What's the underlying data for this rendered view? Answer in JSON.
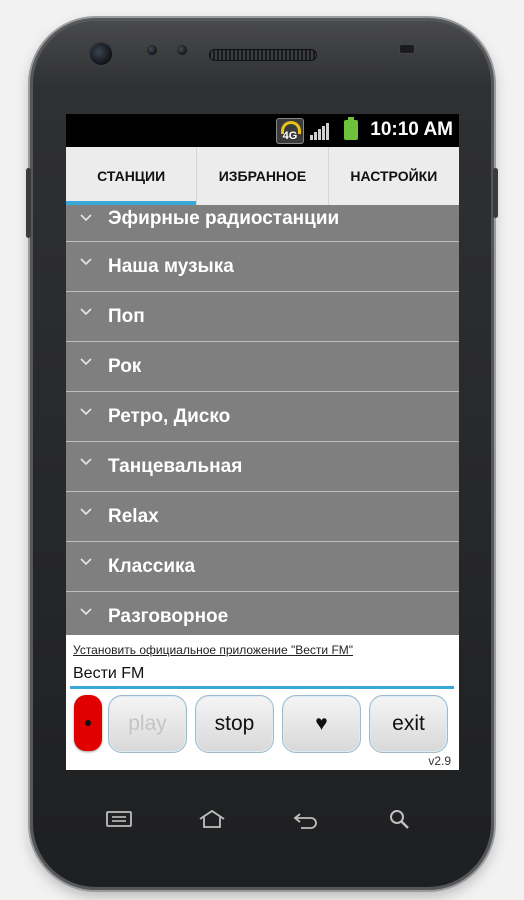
{
  "status_bar": {
    "network": "4G",
    "time": "10:10 AM",
    "icons": [
      "wifi-icon",
      "signal-icon",
      "battery-icon"
    ]
  },
  "tabs": [
    {
      "label": "СТАНЦИИ",
      "active": true
    },
    {
      "label": "ИЗБРАННОЕ",
      "active": false
    },
    {
      "label": "НАСТРОЙКИ",
      "active": false
    }
  ],
  "categories": [
    "Эфирные радиостанции",
    "Наша музыка",
    "Поп",
    "Рок",
    "Ретро, Диско",
    "Танцевальная",
    "Relax",
    "Классика",
    "Разговорное"
  ],
  "player": {
    "install_link": "Установить официальное приложение \"Вести FM\"",
    "station_name": "Вести FM",
    "rec_label": "•",
    "play_label": "play",
    "stop_label": "stop",
    "favorite_label": "♥",
    "exit_label": "exit",
    "version": "v2.9"
  },
  "nav_keys": [
    "menu-icon",
    "home-icon",
    "back-icon",
    "search-icon"
  ],
  "colors": {
    "accent": "#39a8d8",
    "list_bg": "#7f7f7f",
    "record": "#e00000"
  }
}
